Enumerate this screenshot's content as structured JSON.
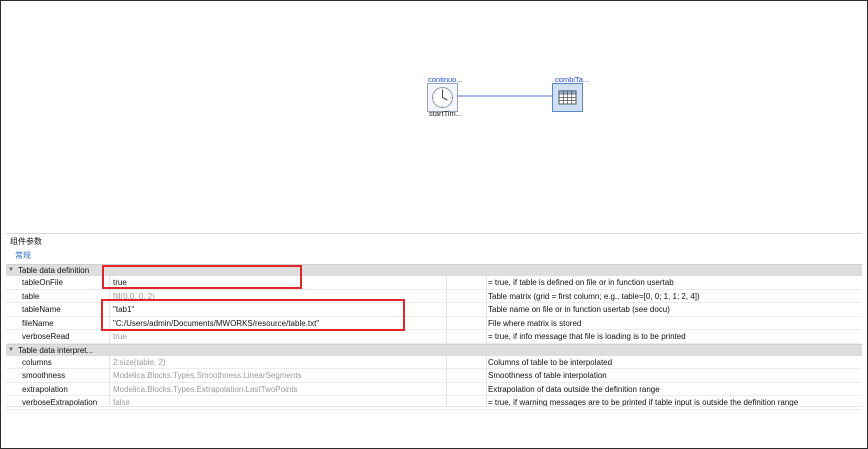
{
  "diagram": {
    "clock_block": {
      "top_label": "continuo...",
      "bottom_label": "startTim..."
    },
    "table_block": {
      "top_label": "combiTa..."
    }
  },
  "panel": {
    "title": "组件参数",
    "tab": "常规"
  },
  "groups": [
    {
      "title": "Table data definition",
      "rows": [
        {
          "name": "tableOnFile",
          "value": "true",
          "value_style": "normal",
          "desc": "= true, if table is defined on file or in function usertab"
        },
        {
          "name": "table",
          "value": "fill(0.0, 0, 2)",
          "value_style": "grey",
          "desc": "Table matrix (grid = first column; e.g., table=[0, 0; 1, 1; 2, 4])"
        },
        {
          "name": "tableName",
          "value": "\"tab1\"",
          "value_style": "normal",
          "desc": "Table name on file or in function usertab (see docu)"
        },
        {
          "name": "fileName",
          "value": "\"C:/Users/admin/Documents/MWORKS/resource/table.txt\"",
          "value_style": "normal",
          "desc": "File where matrix is stored"
        },
        {
          "name": "verboseRead",
          "value": "true",
          "value_style": "grey",
          "desc": "= true, if info message that file is loading is to be printed"
        }
      ]
    },
    {
      "title": "Table data interpret...",
      "rows": [
        {
          "name": "columns",
          "value": "2:size(table, 2)",
          "value_style": "grey",
          "desc": "Columns of table to be interpolated"
        },
        {
          "name": "smoothness",
          "value": "Modelica.Blocks.Types.Smoothness.LinearSegments",
          "value_style": "grey",
          "desc": "Smoothness of table interpolation"
        },
        {
          "name": "extrapolation",
          "value": "Modelica.Blocks.Types.Extrapolation.LastTwoPoints",
          "value_style": "grey",
          "desc": "Extrapolation of data outside the definition range"
        },
        {
          "name": "verboseExtrapolation",
          "value": "false",
          "value_style": "grey",
          "desc": "= true, if warning messages are to be printed if table input is outside the definition range"
        }
      ]
    }
  ],
  "icons": {
    "clock": "clock-icon",
    "table": "table-grid-icon",
    "collapse": "collapse-triangle-icon"
  },
  "colors": {
    "highlight_box": "#e0262a",
    "link_blue": "#1f4fd8",
    "wire": "#1e3fd0",
    "group_header_bg": "#dedede"
  }
}
